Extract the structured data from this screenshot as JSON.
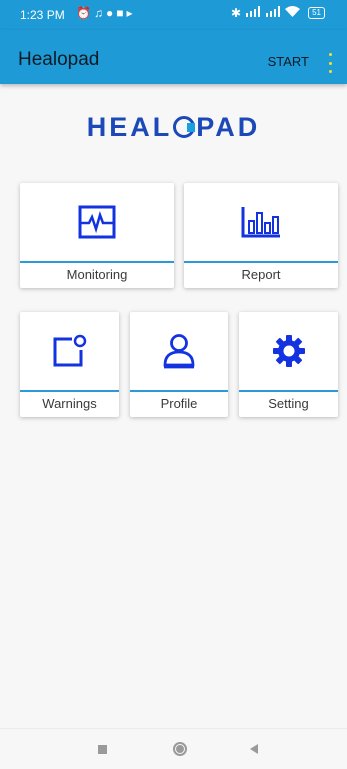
{
  "status_bar": {
    "time": "1:23 PM",
    "battery": "51",
    "left_icons": [
      "alarm-icon",
      "headset-icon",
      "vpn-icon",
      "video-icon",
      "play-icon"
    ],
    "right_icons": [
      "bluetooth-icon",
      "signal-icon",
      "signal-icon",
      "wifi-icon",
      "battery-icon"
    ]
  },
  "app_bar": {
    "title": "Healopad",
    "action_label": "START",
    "more_icon": "more-vert-icon"
  },
  "logo": {
    "prefix": "HEAL",
    "suffix": "PAD"
  },
  "tiles": [
    {
      "label": "Monitoring",
      "icon": "heart-monitor-icon"
    },
    {
      "label": "Report",
      "icon": "bar-chart-icon"
    },
    {
      "label": "Warnings",
      "icon": "notification-icon"
    },
    {
      "label": "Profile",
      "icon": "person-icon"
    },
    {
      "label": "Setting",
      "icon": "gear-icon"
    }
  ],
  "nav_bar": {
    "icons": [
      "recent-apps-icon",
      "home-icon",
      "back-icon"
    ]
  },
  "colors": {
    "primary": "#1e9ad6",
    "icon_blue": "#1433e0",
    "logo_blue": "#1c49b8",
    "background": "#f7f7f7"
  }
}
